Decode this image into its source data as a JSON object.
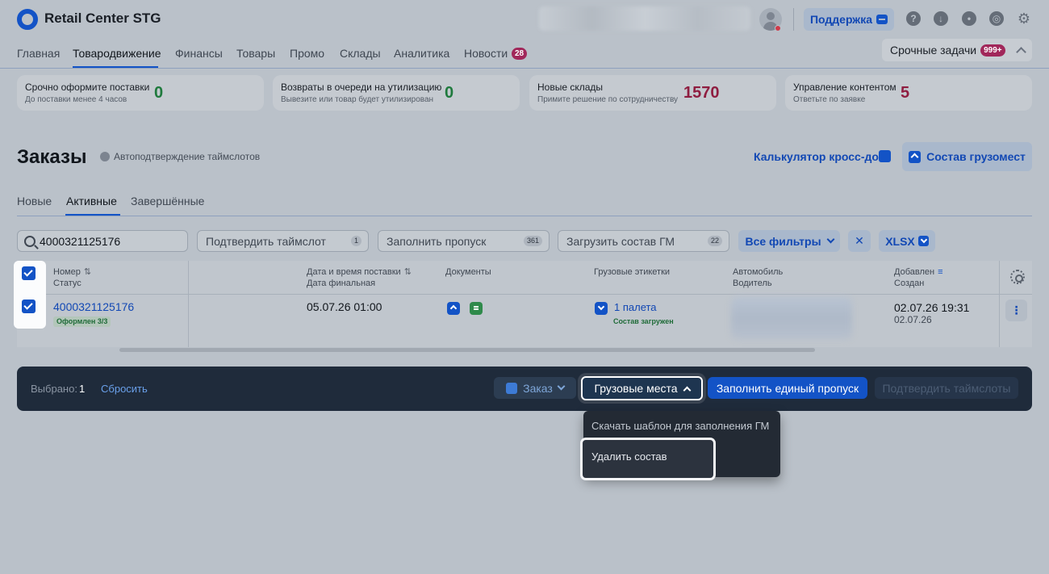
{
  "header": {
    "app_title": "Retail Center STG",
    "support_label": "Поддержка",
    "icons": [
      "help-icon",
      "download-icon",
      "bell-icon",
      "globe-icon",
      "gear-icon"
    ]
  },
  "nav": {
    "items": [
      {
        "label": "Главная"
      },
      {
        "label": "Товародвижение",
        "active": true
      },
      {
        "label": "Финансы"
      },
      {
        "label": "Товары"
      },
      {
        "label": "Промо"
      },
      {
        "label": "Склады"
      },
      {
        "label": "Аналитика"
      },
      {
        "label": "Новости",
        "badge": "28"
      }
    ],
    "urgent_label": "Срочные задачи",
    "urgent_badge": "999+"
  },
  "cards": [
    {
      "title": "Срочно оформите поставки",
      "subtitle": "До поставки менее 4 часов",
      "value": "0",
      "color": "#1f7a3d"
    },
    {
      "title": "Возвраты в очереди на утилизацию",
      "subtitle": "Вывезите или товар будет утилизирован",
      "value": "0",
      "color": "#1f7a3d"
    },
    {
      "title": "Новые склады",
      "subtitle": "Примите решение по сотрудничеству",
      "value": "1570",
      "color": "#8f1d40"
    },
    {
      "title": "Управление контентом",
      "subtitle": "Ответьте по заявке",
      "value": "5",
      "color": "#8f1d40"
    }
  ],
  "page": {
    "title": "Заказы",
    "auto_label": "Автоподтверждение таймслотов",
    "calc_link": "Калькулятор кросс-док",
    "cargo_btn": "Состав грузомест"
  },
  "sub_tabs": [
    {
      "label": "Новые"
    },
    {
      "label": "Активные",
      "active": true
    },
    {
      "label": "Завершённые"
    }
  ],
  "filters": {
    "search_value": "4000321125176",
    "boxes": [
      {
        "label": "Подтвердить таймслот",
        "count": "1"
      },
      {
        "label": "Заполнить пропуск",
        "count": "361"
      },
      {
        "label": "Загрузить состав ГМ",
        "count": "22"
      }
    ],
    "all_filters": "Все фильтры",
    "clear": "✕",
    "xlsx": "XLSX"
  },
  "table": {
    "headers": {
      "number": "Номер",
      "status": "Статус",
      "date": "Дата и время поставки",
      "date_final": "Дата финальная",
      "docs": "Документы",
      "labels": "Грузовые этикетки",
      "car": "Автомобиль",
      "driver": "Водитель",
      "added": "Добавлен",
      "created": "Создан"
    },
    "rows": [
      {
        "number": "4000321125176",
        "status": "Оформлен 3/3",
        "date": "05.07.26 01:00",
        "labels": "1 палета",
        "labels_status": "Состав загружен",
        "added": "02.07.26 19:31",
        "created": "02.07.26"
      }
    ]
  },
  "action_bar": {
    "selected_label": "Выбрано:",
    "selected_count": "1",
    "reset": "Сбросить",
    "order_btn": "Заказ",
    "cargo_btn": "Грузовые места",
    "fill_pass_btn": "Заполнить единый пропуск",
    "confirm_btn": "Подтвердить таймслоты"
  },
  "dropdown": {
    "items": [
      "Скачать шаблон для заполнения ГМ",
      "Удалить состав"
    ]
  }
}
